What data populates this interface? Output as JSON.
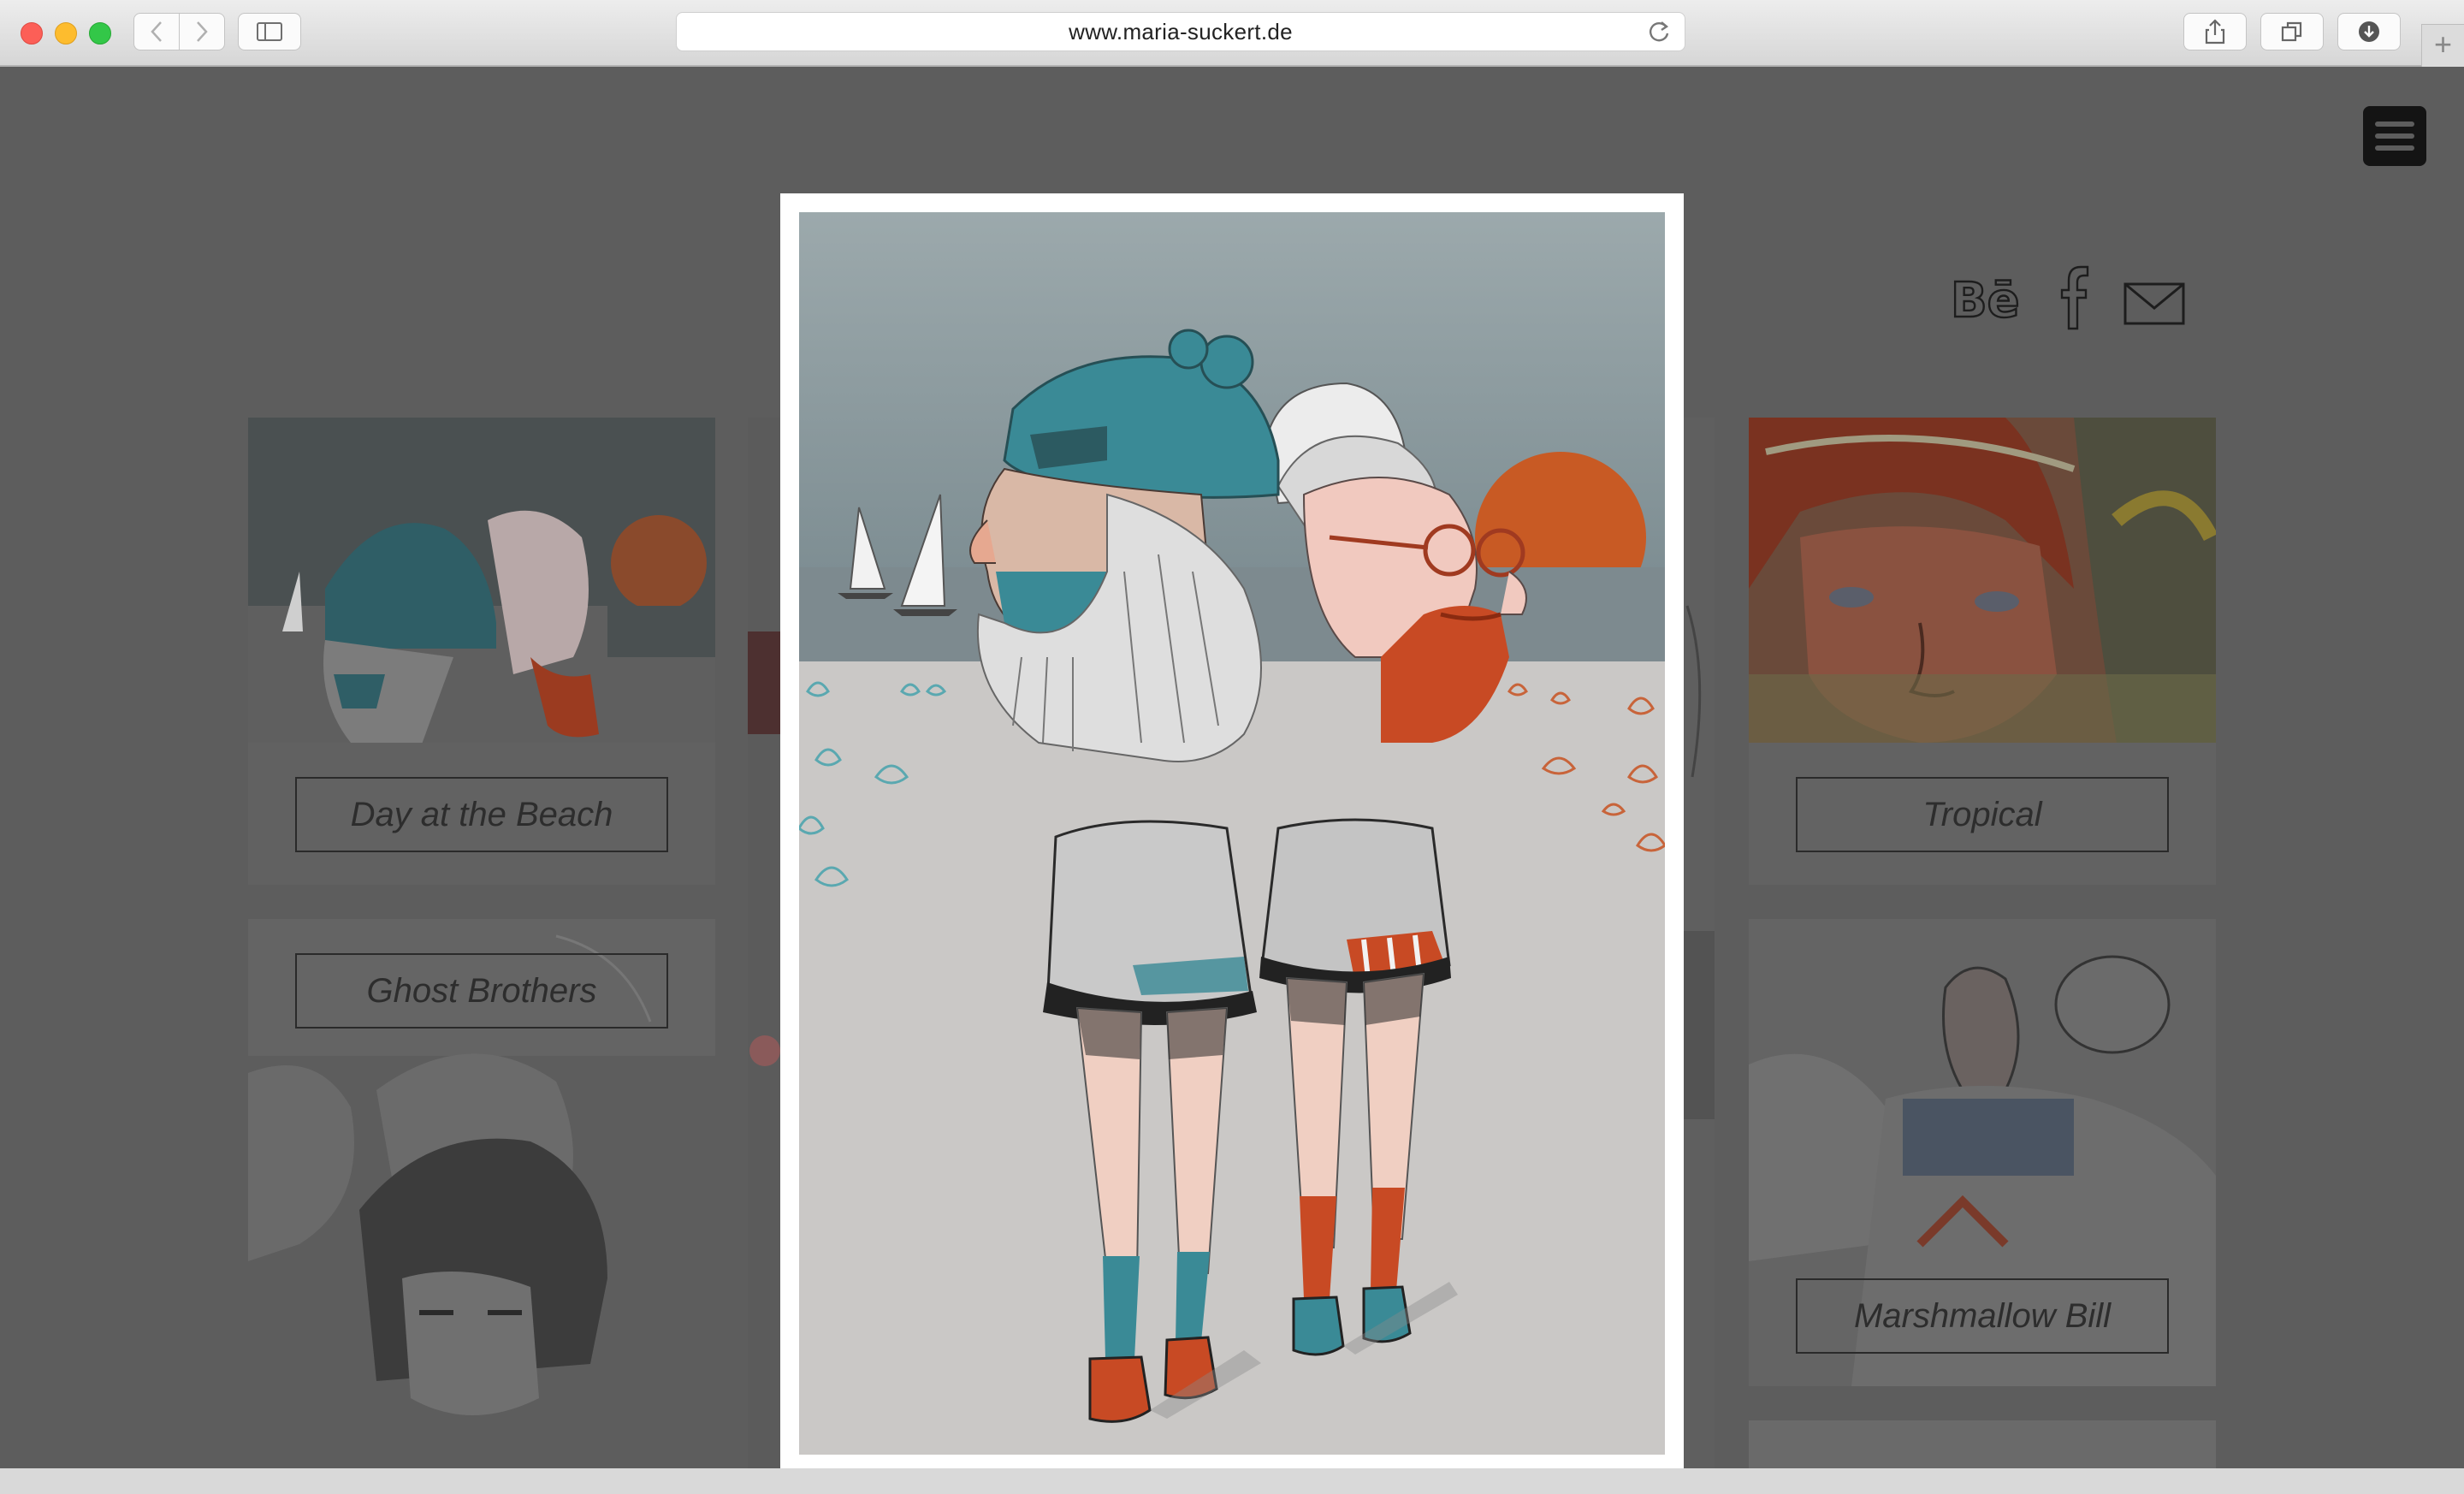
{
  "browser": {
    "url": "www.maria-suckert.de",
    "buttons": {
      "back": "back",
      "forward": "forward",
      "sidebar": "sidebar",
      "share": "share",
      "tabs": "tabs",
      "downloads": "downloads",
      "new_tab": "+"
    }
  },
  "site": {
    "social": [
      "behance",
      "facebook",
      "email"
    ]
  },
  "gallery": {
    "tiles": [
      {
        "label": "Day at the Beach"
      },
      {
        "label": "Ghost Brothers"
      },
      {
        "label": "Tropical"
      },
      {
        "label": "Marshmallow Bill"
      }
    ]
  },
  "colors": {
    "overlay": "#5d5d5d",
    "teal": "#3a8a96",
    "orange": "#c8552a",
    "sky": "#8a9ba0"
  }
}
